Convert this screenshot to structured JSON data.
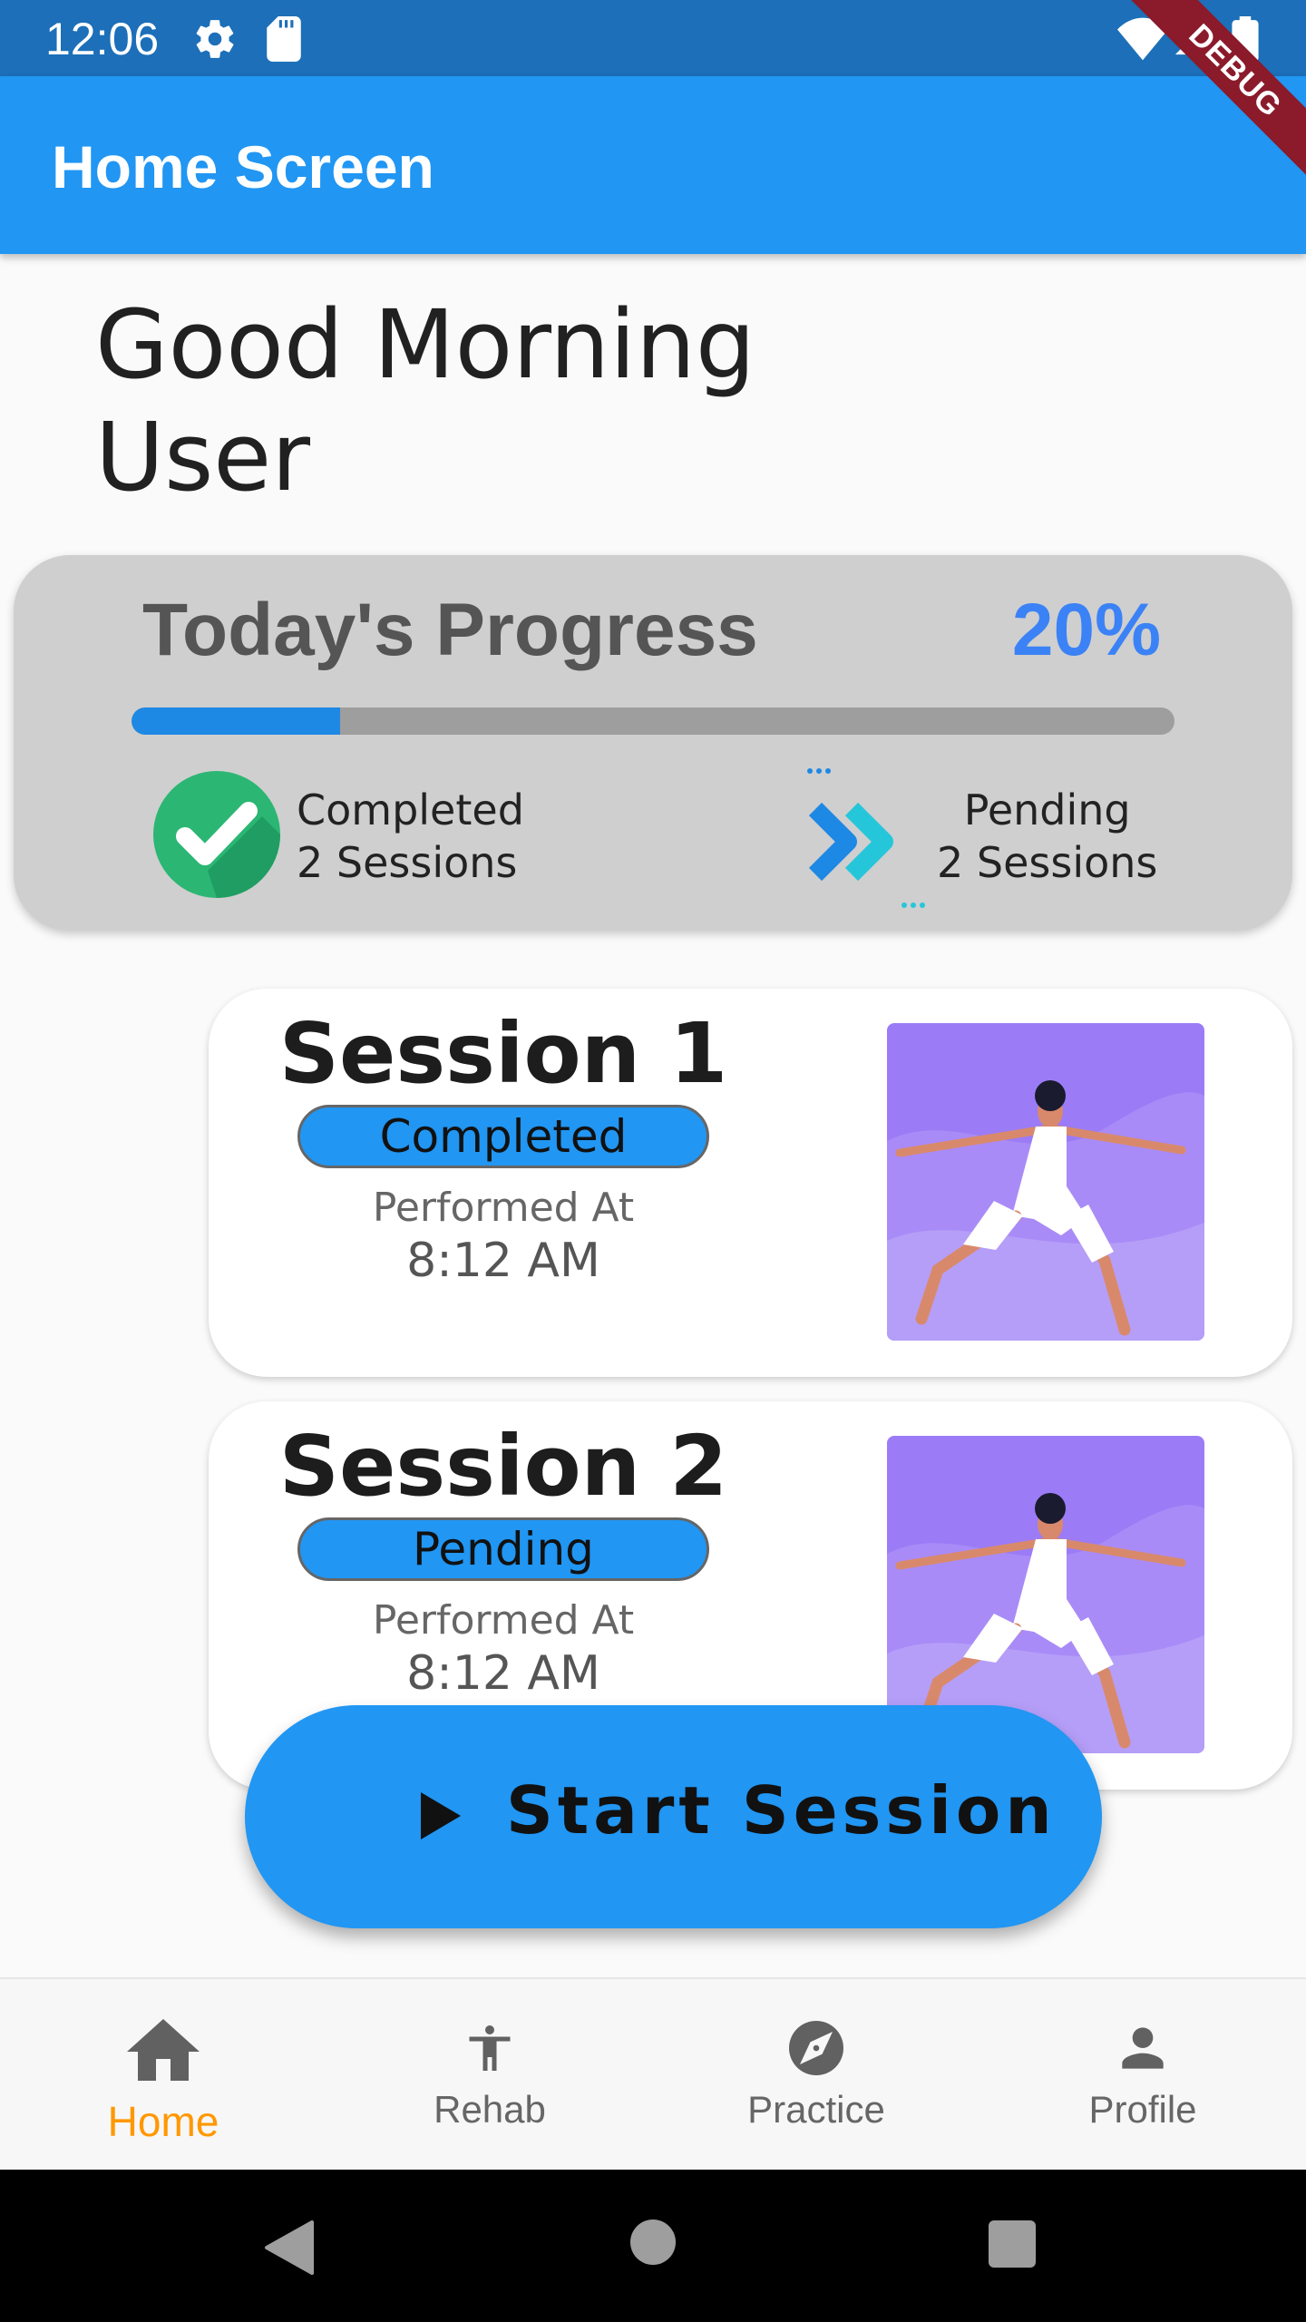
{
  "status_bar": {
    "time": "12:06",
    "icons": [
      "settings-gear-icon",
      "sd-card-icon",
      "wifi-icon",
      "signal-icon",
      "battery-icon"
    ]
  },
  "debug_banner": "DEBUG",
  "app_bar": {
    "title": "Home Screen"
  },
  "greeting": {
    "line1": "Good Morning",
    "line2": "User"
  },
  "progress": {
    "title": "Today's Progress",
    "percent_label": "20%",
    "fraction": 0.2,
    "completed": {
      "label": "Completed",
      "sessions": "2 Sessions",
      "icon": "check-circle-icon"
    },
    "pending": {
      "label": "Pending",
      "sessions": "2 Sessions",
      "icon": "double-chevron-right-icon"
    }
  },
  "sessions": [
    {
      "title": "Session 1",
      "status": "Completed",
      "performed_label": "Performed At",
      "time": "8:12 AM",
      "image": "yoga-warrior-pose-image"
    },
    {
      "title": "Session 2",
      "status": "Pending",
      "performed_label": "Performed At",
      "time": "8:12 AM",
      "image": "yoga-warrior-pose-image"
    }
  ],
  "start_button": {
    "label": "Start Session",
    "icon": "play-icon"
  },
  "bottom_nav": {
    "items": [
      {
        "label": "Home",
        "icon": "home-icon",
        "active": true
      },
      {
        "label": "Rehab",
        "icon": "accessibility-icon",
        "active": false
      },
      {
        "label": "Practice",
        "icon": "compass-icon",
        "active": false
      },
      {
        "label": "Profile",
        "icon": "person-icon",
        "active": false
      }
    ]
  },
  "colors": {
    "primary": "#2196f3",
    "status_bar": "#1c6fb8",
    "active_nav": "#ff9800",
    "progress_pct": "#3b82f6",
    "card_grey": "#cfcfcf"
  }
}
